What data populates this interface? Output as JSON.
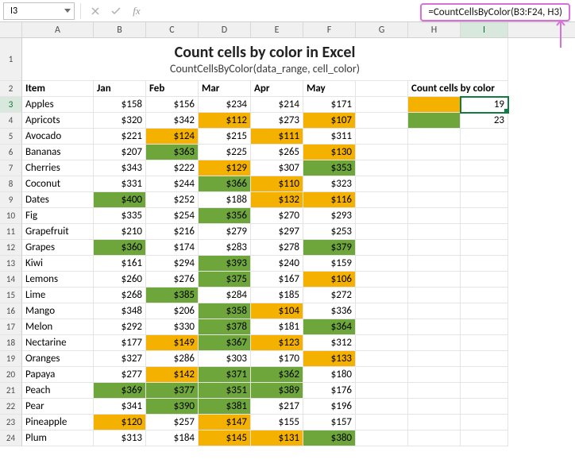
{
  "nameBox": "I3",
  "formulaCallout": "=CountCellsByColor(B3:F24, H3)",
  "title": "Count cells by color in Excel",
  "subtitle": "CountCellsByColor(data_range, cell_color)",
  "columns": [
    "",
    "A",
    "B",
    "C",
    "D",
    "E",
    "F",
    "G",
    "H",
    "I"
  ],
  "headers": {
    "item": "Item",
    "jan": "Jan",
    "feb": "Feb",
    "mar": "Mar",
    "apr": "Apr",
    "may": "May"
  },
  "summary": {
    "title": "Count cells by color",
    "orange_count": "19",
    "green_count": "23"
  },
  "colors": {
    "orange": "#f5b100",
    "green": "#6ea63b"
  },
  "rows": [
    {
      "n": "3",
      "item": "Apples",
      "v": [
        "$158",
        "$156",
        "$234",
        "$214",
        "$171"
      ],
      "f": [
        null,
        null,
        null,
        null,
        null
      ]
    },
    {
      "n": "4",
      "item": "Apricots",
      "v": [
        "$320",
        "$342",
        "$112",
        "$273",
        "$107"
      ],
      "f": [
        null,
        null,
        "orange",
        null,
        "orange"
      ]
    },
    {
      "n": "5",
      "item": "Avocado",
      "v": [
        "$221",
        "$124",
        "$215",
        "$111",
        "$311"
      ],
      "f": [
        null,
        "orange",
        null,
        "orange",
        null
      ]
    },
    {
      "n": "6",
      "item": "Bananas",
      "v": [
        "$207",
        "$363",
        "$225",
        "$265",
        "$130"
      ],
      "f": [
        null,
        "green",
        null,
        null,
        "orange"
      ]
    },
    {
      "n": "7",
      "item": "Cherries",
      "v": [
        "$343",
        "$222",
        "$129",
        "$307",
        "$353"
      ],
      "f": [
        null,
        null,
        "orange",
        null,
        "green"
      ]
    },
    {
      "n": "8",
      "item": "Coconut",
      "v": [
        "$331",
        "$244",
        "$366",
        "$110",
        "$323"
      ],
      "f": [
        null,
        null,
        "green",
        "orange",
        null
      ]
    },
    {
      "n": "9",
      "item": "Dates",
      "v": [
        "$400",
        "$252",
        "$188",
        "$132",
        "$116"
      ],
      "f": [
        "green",
        null,
        null,
        "orange",
        "orange"
      ]
    },
    {
      "n": "10",
      "item": "Fig",
      "v": [
        "$335",
        "$254",
        "$356",
        "$270",
        "$293"
      ],
      "f": [
        null,
        null,
        "green",
        null,
        null
      ]
    },
    {
      "n": "11",
      "item": "Grapefruit",
      "v": [
        "$210",
        "$216",
        "$279",
        "$297",
        "$253"
      ],
      "f": [
        null,
        null,
        null,
        null,
        null
      ]
    },
    {
      "n": "12",
      "item": "Grapes",
      "v": [
        "$360",
        "$174",
        "$283",
        "$278",
        "$379"
      ],
      "f": [
        "green",
        null,
        null,
        null,
        "green"
      ]
    },
    {
      "n": "13",
      "item": "Kiwi",
      "v": [
        "$161",
        "$294",
        "$393",
        "$240",
        "$159"
      ],
      "f": [
        null,
        null,
        "green",
        null,
        null
      ]
    },
    {
      "n": "14",
      "item": "Lemons",
      "v": [
        "$260",
        "$276",
        "$375",
        "$167",
        "$106"
      ],
      "f": [
        null,
        null,
        "green",
        null,
        "orange"
      ]
    },
    {
      "n": "15",
      "item": "Lime",
      "v": [
        "$268",
        "$385",
        "$284",
        "$185",
        "$272"
      ],
      "f": [
        null,
        "green",
        null,
        null,
        null
      ]
    },
    {
      "n": "16",
      "item": "Mango",
      "v": [
        "$348",
        "$206",
        "$358",
        "$104",
        "$336"
      ],
      "f": [
        null,
        null,
        "green",
        "orange",
        null
      ]
    },
    {
      "n": "17",
      "item": "Melon",
      "v": [
        "$292",
        "$330",
        "$378",
        "$181",
        "$364"
      ],
      "f": [
        null,
        null,
        "green",
        null,
        "green"
      ]
    },
    {
      "n": "18",
      "item": "Nectarine",
      "v": [
        "$177",
        "$149",
        "$367",
        "$123",
        "$312"
      ],
      "f": [
        null,
        "orange",
        "green",
        "orange",
        null
      ]
    },
    {
      "n": "19",
      "item": "Oranges",
      "v": [
        "$327",
        "$286",
        "$303",
        "$170",
        "$133"
      ],
      "f": [
        null,
        null,
        null,
        null,
        "orange"
      ]
    },
    {
      "n": "20",
      "item": "Papaya",
      "v": [
        "$277",
        "$142",
        "$371",
        "$362",
        "$180"
      ],
      "f": [
        null,
        "orange",
        "green",
        "green",
        null
      ]
    },
    {
      "n": "21",
      "item": "Peach",
      "v": [
        "$369",
        "$377",
        "$351",
        "$389",
        "$176"
      ],
      "f": [
        "green",
        "green",
        "green",
        "green",
        null
      ]
    },
    {
      "n": "22",
      "item": "Pear",
      "v": [
        "$341",
        "$390",
        "$381",
        "$217",
        "$196"
      ],
      "f": [
        null,
        "green",
        "green",
        null,
        null
      ]
    },
    {
      "n": "23",
      "item": "Pineapple",
      "v": [
        "$120",
        "$257",
        "$147",
        "$155",
        "$157"
      ],
      "f": [
        "orange",
        null,
        "orange",
        null,
        null
      ]
    },
    {
      "n": "24",
      "item": "Plum",
      "v": [
        "$313",
        "$184",
        "$145",
        "$131",
        "$380"
      ],
      "f": [
        null,
        null,
        "orange",
        "orange",
        "green"
      ]
    }
  ]
}
